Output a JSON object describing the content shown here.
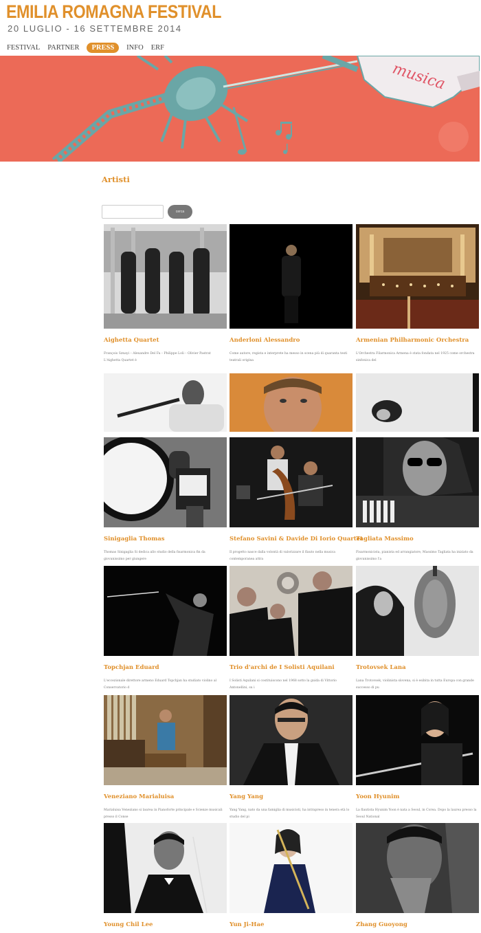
{
  "header": {
    "logo_title": "EMILIA ROMAGNA FESTIVAL",
    "logo_subtitle": "20 LUGLIO - 16 SETTEMBRE 2014"
  },
  "nav": {
    "items": [
      "FESTIVAL",
      "PARTNER",
      "PRESS",
      "INFO",
      "ERF"
    ],
    "active": "PRESS"
  },
  "banner": {
    "ribbon_text": "musica"
  },
  "page": {
    "section_title": "Artisti"
  },
  "search": {
    "value": "",
    "button_label": "cerca"
  },
  "colors": {
    "accent": "#e0902b",
    "banner_bg": "#ec6a57",
    "banner_teal": "#6aa6a6"
  },
  "artists": [
    {
      "name": "Aighetta Quartet",
      "desc": "François Sznayi – Alexandre Del Fa – Philippe Loli – Olivier Pastrat L'Aighetta Quartet è",
      "photo": "bw-group"
    },
    {
      "name": "Anderloni Alessandro",
      "desc": "Come autore, regista e interprete ha messo in scena più di quaranta testi teatrali origina",
      "photo": "dark-stage"
    },
    {
      "name": "Armenian Philharmonic Orchestra",
      "desc": "L'Orchestra Filarmonica Armena è stata fondata nel 1925 come orchestra sinfonica del",
      "photo": "concert-hall"
    },
    {
      "name": "",
      "desc": "",
      "photo": "bw-clarinet"
    },
    {
      "name": "",
      "desc": "",
      "photo": "warm-portrait"
    },
    {
      "name": "",
      "desc": "",
      "photo": "bw-portrait"
    },
    {
      "name": "Sinigaglia Thomas",
      "desc": "Thomas Sinigaglia Si dedica allo studio della fisarmonica fin da giovanissimo per giungere",
      "photo": "bw-accordion"
    },
    {
      "name": "Stefano Savini & Davide Di Iorio Quartet",
      "desc": "Il progetto nasce dalla volontà di valorizzare il flauto nella musica contemporanea attra",
      "photo": "color-duo"
    },
    {
      "name": "Tagliata Massimo",
      "desc": "Fisarmonicista, pianista ed arrangiatore, Massimo Tagliata ha iniziato da giovanissimo l'a",
      "photo": "bw-glasses"
    },
    {
      "name": "Topchjan Eduard",
      "desc": "L'eccezionale direttore armeno Eduard Topchjan ha studiato violino al Conservatorio d",
      "photo": "conductor"
    },
    {
      "name": "Trio d'archi de I Solisti Aquilani",
      "desc": "I Solisti Aquilani si costituiscono nel 1968 sotto la guida di Vittorio Antonellini, su i",
      "photo": "trio"
    },
    {
      "name": "Trotovsek Lana",
      "desc": "Lana Trotovsek, violinista slovena, si è esibita in tutta Europa con grande successo di pu",
      "photo": "violinist"
    },
    {
      "name": "Veneziano Marialuisa",
      "desc": "Marialuisa Veneziano si laurea in Pianoforte principale e Scienze musicali presso il Conse",
      "photo": "organ"
    },
    {
      "name": "Yang Yang",
      "desc": "Yang Yang, nato da una famiglia di musicisti, ha intrapreso in tenera età lo studio del pi",
      "photo": "yang"
    },
    {
      "name": "Yoon Hyunim",
      "desc": "La flautista Hyunim Yoon è nata a Seoul, in Corea. Dopo la laurea presso la Seoul National",
      "photo": "flutist"
    },
    {
      "name": "Young Chil Lee",
      "desc": "",
      "photo": "bw-conductor"
    },
    {
      "name": "Yun Ji-Hae",
      "desc": "",
      "photo": "flute-woman"
    },
    {
      "name": "Zhang Guoyong",
      "desc": "",
      "photo": "bw-hands"
    }
  ]
}
